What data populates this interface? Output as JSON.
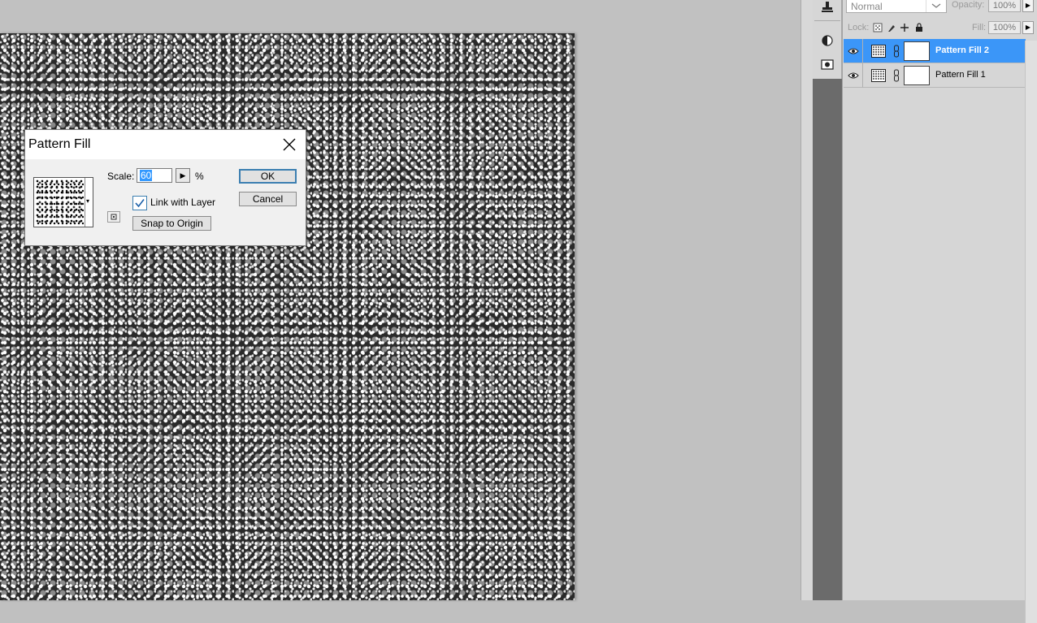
{
  "dialog": {
    "title": "Pattern Fill",
    "scale_label": "Scale:",
    "scale_value": "60",
    "scale_unit": "%",
    "link_with_layer_label": "Link with Layer",
    "link_with_layer_checked": true,
    "snap_label": "Snap to Origin",
    "ok_label": "OK",
    "cancel_label": "Cancel"
  },
  "layers_panel": {
    "blend_mode": "Normal",
    "opacity_label": "Opacity:",
    "opacity_value": "100%",
    "lock_label": "Lock:",
    "fill_label": "Fill:",
    "fill_value": "100%",
    "layers": [
      {
        "name": "Pattern Fill 2",
        "selected": true,
        "visible": true
      },
      {
        "name": "Pattern Fill 1",
        "selected": false,
        "visible": true
      }
    ]
  },
  "colors": {
    "selection": "#3b96f8",
    "dialog_bg": "#f0f0f0",
    "workspace": "#c1c1c1"
  }
}
